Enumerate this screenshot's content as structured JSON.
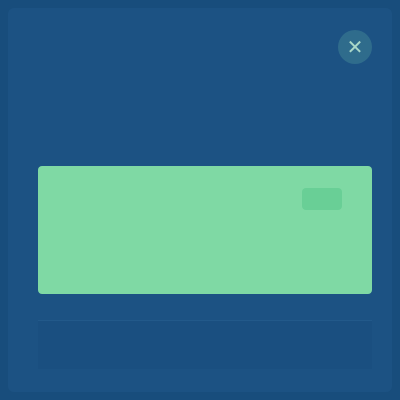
{
  "dialog": {
    "title": "",
    "close_icon": "close-icon",
    "close_glyph": "✕",
    "message": "",
    "colors": {
      "background": "#184d7c",
      "banner": "#7fd9a4",
      "accent": "#69cf96"
    }
  }
}
